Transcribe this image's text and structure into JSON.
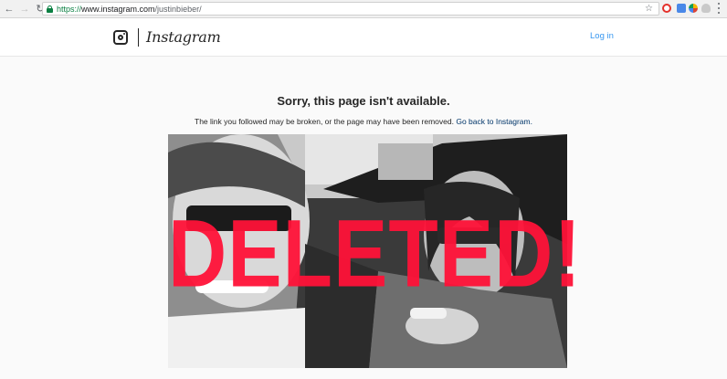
{
  "browser": {
    "url_scheme": "https://",
    "url_host": "www.instagram.com",
    "url_path": "/justinbieber/",
    "back_icon": "arrow-left-icon",
    "forward_icon": "arrow-right-icon",
    "reload_icon": "reload-icon",
    "star_icon": "star-icon",
    "menu_icon": "kebab-menu-icon"
  },
  "header": {
    "wordmark": "Instagram",
    "login_label": "Log in"
  },
  "error": {
    "title": "Sorry, this page isn't available.",
    "message": "The link you followed may be broken, or the page may have been removed.",
    "link_text": "Go back to Instagram."
  },
  "photo": {
    "overlay_text": "DELETED!",
    "overlay_color": "#ff1238"
  },
  "colors": {
    "accent": "#3897f0",
    "link": "#003569"
  }
}
